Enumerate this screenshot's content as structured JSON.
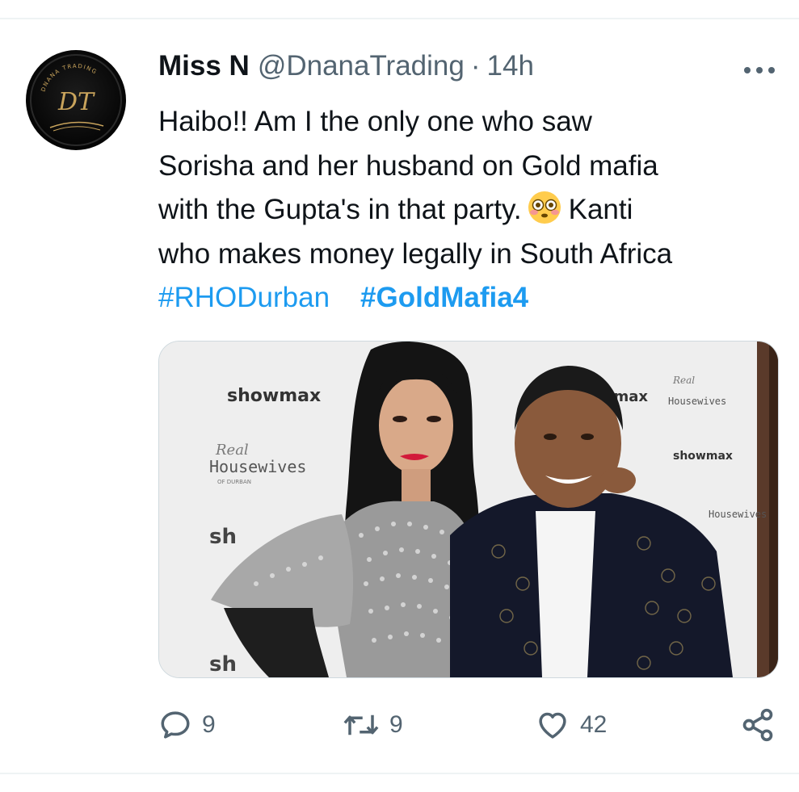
{
  "tweet": {
    "author": {
      "display_name": "Miss N",
      "handle": "@DnanaTrading",
      "avatar_monogram": "DT",
      "avatar_ring_text": "DNANA TRADING"
    },
    "separator": "·",
    "timestamp": "14h",
    "more_label": "More",
    "text_lines": [
      "Haibo!! Am I the only one who saw",
      "Sorisha and her husband on Gold mafia",
      "with the Gupta's in that party.",
      "Kanti",
      "who makes money legally in South Africa"
    ],
    "emoji": "flushed-face",
    "hashtags": [
      "#RHODurban",
      "#GoldMafia4"
    ],
    "media": {
      "backdrop_texts": [
        "showmax",
        "Real",
        "Housewives",
        "OF DURBAN",
        "sh"
      ]
    },
    "actions": {
      "reply_count": "9",
      "retweet_count": "9",
      "like_count": "42"
    }
  },
  "colors": {
    "link": "#1d9bf0",
    "secondary_text": "#536471",
    "primary_text": "#0f1419",
    "divider": "#eff3f4",
    "avatar_gold": "#c9a45c"
  },
  "icons": {
    "more": "ellipsis-icon",
    "reply": "reply-bubble-icon",
    "retweet": "retweet-icon",
    "like": "heart-icon",
    "share": "share-icon"
  }
}
